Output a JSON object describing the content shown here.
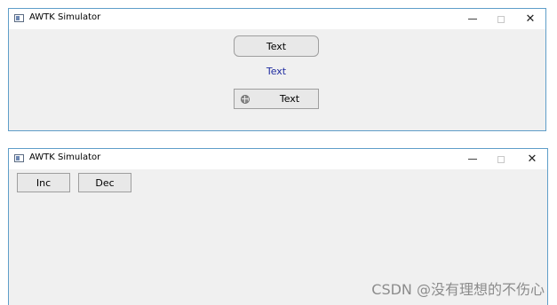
{
  "window1": {
    "title": "AWTK Simulator",
    "button_rounded_label": "Text",
    "label_text": "Text",
    "button_icon_label": "Text"
  },
  "window2": {
    "title": "AWTK Simulator",
    "inc_label": "Inc",
    "dec_label": "Dec"
  },
  "titlebar_controls": {
    "close_glyph": "✕"
  },
  "watermark": "CSDN @没有理想的不伤心",
  "colors": {
    "window_border": "#5f9ec9",
    "client_bg": "#f0f0f0",
    "label_text": "#1f2ca0"
  }
}
